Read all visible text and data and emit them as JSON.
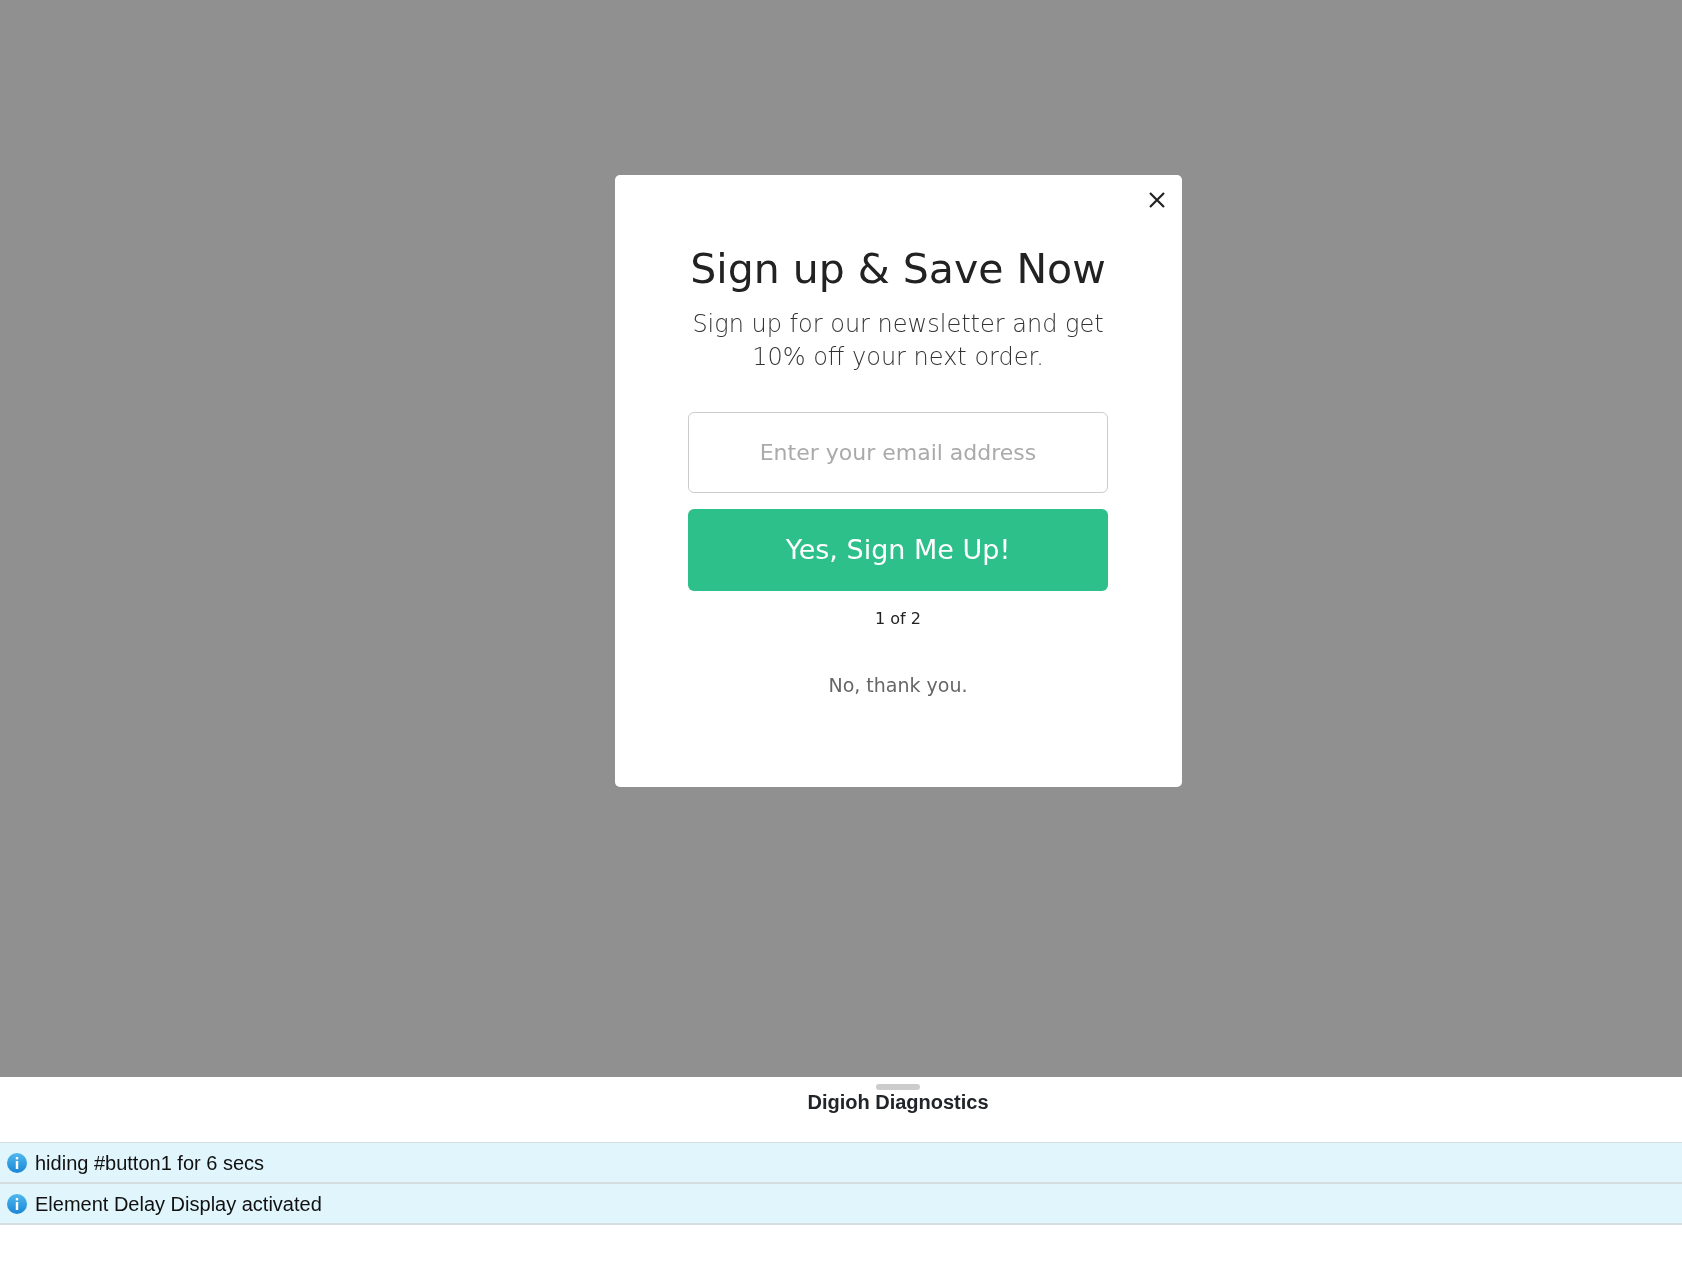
{
  "modal": {
    "title": "Sign up & Save Now",
    "subtitle": "Sign up for our newsletter and get 10% off your next order.",
    "email_field": {
      "placeholder": "Enter your email address"
    },
    "submit_button": "Yes, Sign Me Up!",
    "step": "1 of 2",
    "decline_link": "No, thank you."
  },
  "diagnostics": {
    "title": "Digioh Diagnostics",
    "messages": [
      {
        "kind": "info",
        "text": "hiding #button1 for 6 secs"
      },
      {
        "kind": "info",
        "text": "Element Delay Display activated"
      }
    ]
  }
}
